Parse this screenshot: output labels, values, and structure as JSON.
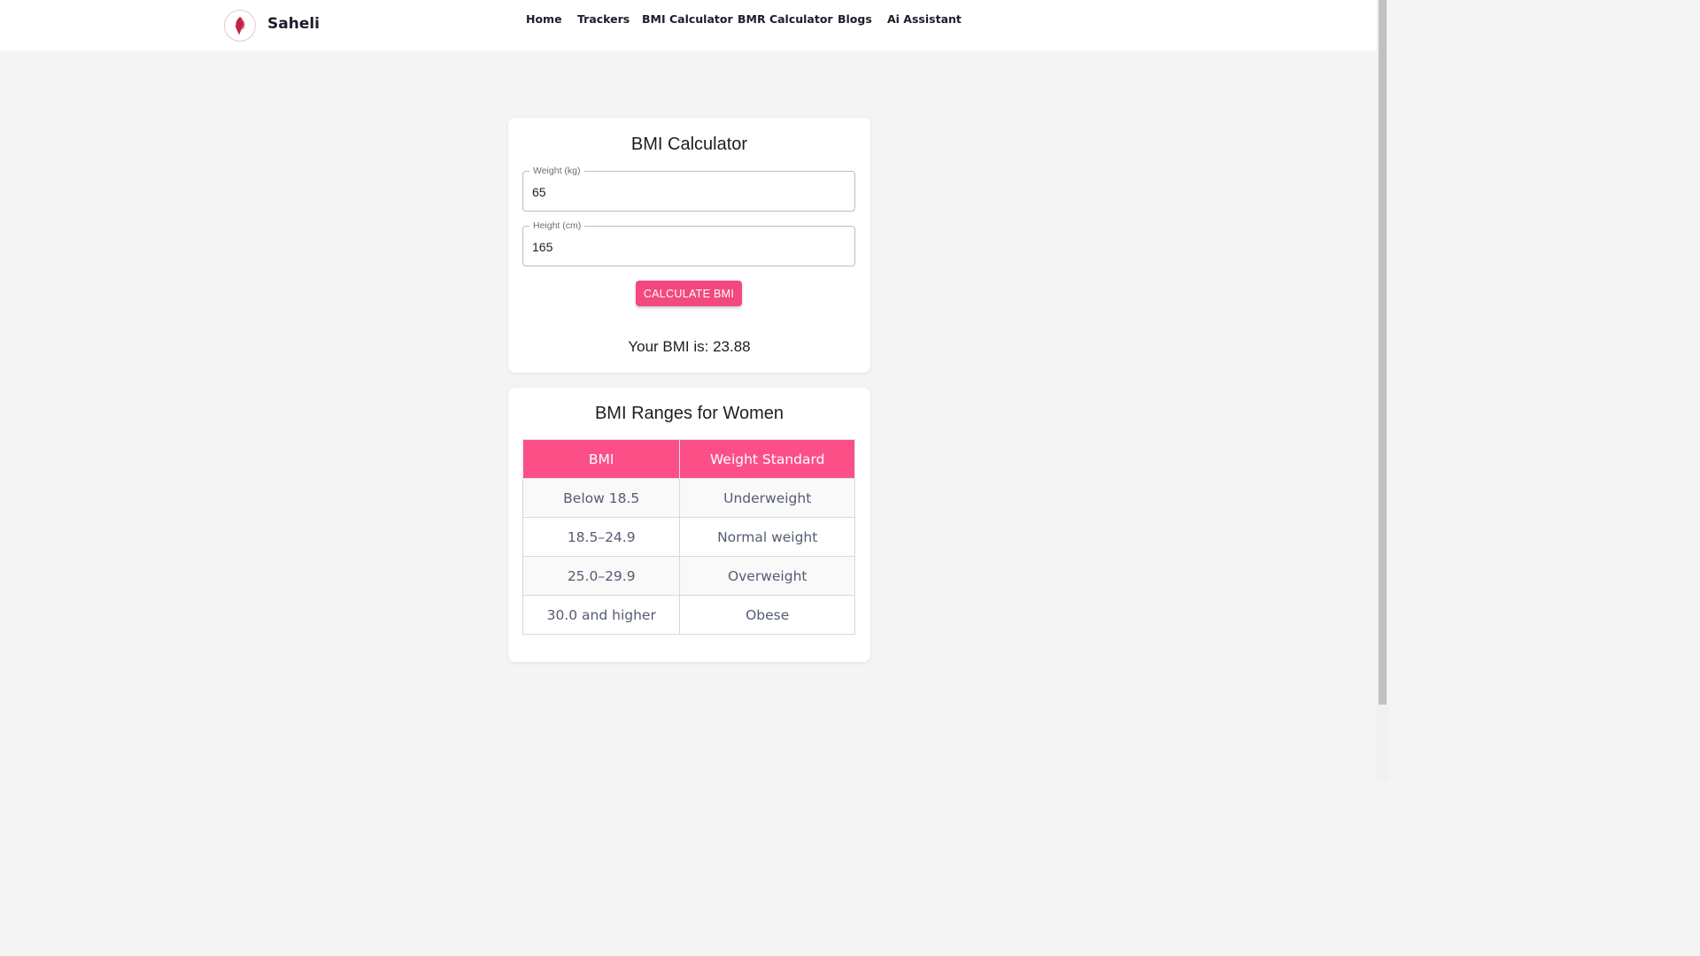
{
  "brand": {
    "name": "Saheli",
    "logo_icon": "saheli-logo-icon",
    "accent": "#c0244a"
  },
  "nav": {
    "items": [
      {
        "label": "Home"
      },
      {
        "label": "Trackers"
      },
      {
        "label": "BMI Calculator"
      },
      {
        "label": "BMR Calculator"
      },
      {
        "label": "Blogs"
      },
      {
        "label": "Ai Assistant"
      }
    ]
  },
  "calculator": {
    "title": "BMI Calculator",
    "weight": {
      "label": "Weight (kg)",
      "value": "65"
    },
    "height": {
      "label": "Height (cm)",
      "value": "165"
    },
    "button_label": "CALCULATE BMI",
    "result_text": "Your BMI is: 23.88"
  },
  "ranges": {
    "title": "BMI Ranges for Women",
    "headers": [
      "BMI",
      "Weight Standard"
    ],
    "rows": [
      [
        "Below 18.5",
        "Underweight"
      ],
      [
        "18.5–24.9",
        "Normal weight"
      ],
      [
        "25.0–29.9",
        "Overweight"
      ],
      [
        "30.0 and higher",
        "Obese"
      ]
    ]
  },
  "colors": {
    "primary_button": "#f2497f",
    "table_header": "#fc4f87",
    "page_background": "#f4f4f4"
  }
}
